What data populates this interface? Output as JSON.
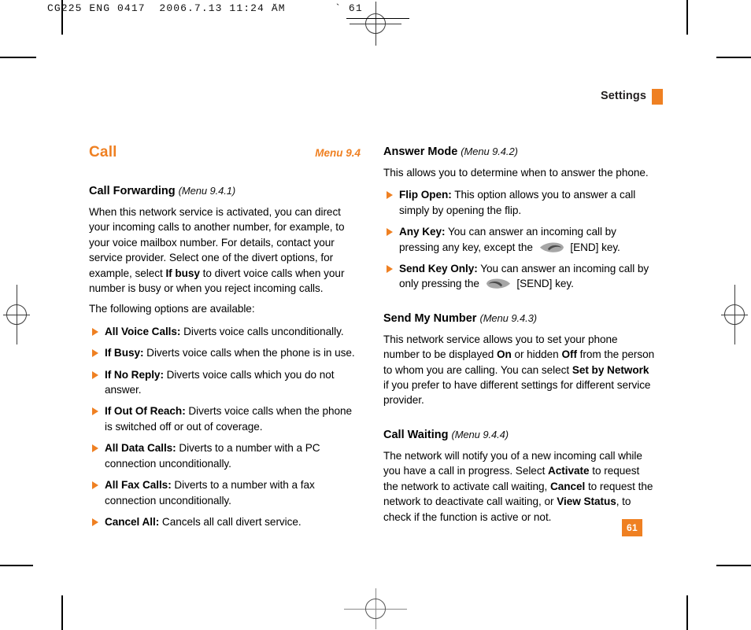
{
  "scan": {
    "slug_left": "CG225 ENG 0417  2006.7.13 11:24 AM",
    "slug_right": "˘        ` 61"
  },
  "running_head": {
    "label": "Settings"
  },
  "page_number": "61",
  "left_column": {
    "section_title": "Call",
    "section_menu_ref": "Menu 9.4",
    "subsection": {
      "title": "Call Forwarding",
      "menu_ref": "(Menu 9.4.1)",
      "paragraph_1_pre": "When this network service is activated, you can direct your incoming calls to another number, for example, to your voice mailbox number. For details, contact your service provider. Select one of the divert options, for example, select ",
      "paragraph_1_bold": "If busy",
      "paragraph_1_post": " to divert voice calls when your number is busy or when you reject incoming calls.",
      "paragraph_2": "The following options are available:",
      "options": [
        {
          "label": "All Voice Calls:",
          "text": " Diverts voice calls unconditionally."
        },
        {
          "label": "If Busy:",
          "text": " Diverts voice calls when the phone is in use."
        },
        {
          "label": "If No Reply:",
          "text": " Diverts voice calls which you do not answer."
        },
        {
          "label": "If Out Of Reach:",
          "text": " Diverts voice calls when the phone is switched off or out of coverage."
        },
        {
          "label": "All Data Calls:",
          "text": " Diverts to a number with a PC connection unconditionally."
        },
        {
          "label": "All Fax Calls:",
          "text": " Diverts to a number with a fax connection unconditionally."
        },
        {
          "label": "Cancel All:",
          "text": " Cancels all call divert service."
        }
      ]
    }
  },
  "right_column": {
    "answer_mode": {
      "title": "Answer Mode",
      "menu_ref": "(Menu 9.4.2)",
      "paragraph": "This allows you to determine when to answer the phone.",
      "options": [
        {
          "label": "Flip Open:",
          "text": " This option allows you to answer a call simply by opening the flip."
        },
        {
          "label": "Any Key:",
          "text_pre": " You can answer an incoming call by pressing any key, except the ",
          "icon": "end-key-icon",
          "text_post": " [END] key."
        },
        {
          "label": "Send Key Only:",
          "text_pre": " You can answer an incoming call by only pressing the ",
          "icon": "send-key-icon",
          "text_post": " [SEND] key."
        }
      ]
    },
    "send_my_number": {
      "title": "Send My Number",
      "menu_ref": "(Menu 9.4.3)",
      "p_a": "This network service allows you to set your phone number to be displayed ",
      "b_on": "On",
      "p_b": " or hidden ",
      "b_off": "Off",
      "p_c": " from the person to whom you are calling. You can select ",
      "b_setby": "Set by Network",
      "p_d": " if you prefer to have different settings for different service provider."
    },
    "call_waiting": {
      "title": "Call Waiting",
      "menu_ref": "(Menu 9.4.4)",
      "p_a": "The network will notify you of a new incoming call while you have a call in progress. Select ",
      "b_activate": "Activate",
      "p_b": " to request the network to activate call waiting, ",
      "b_cancel": "Cancel",
      "p_c": " to request the network to deactivate call waiting, or ",
      "b_view": "View Status",
      "p_d": ", to check if the function is active or not."
    }
  },
  "colors": {
    "accent": "#ef8022",
    "text": "#000000",
    "key_icon_gray": "#9b9b9b"
  }
}
